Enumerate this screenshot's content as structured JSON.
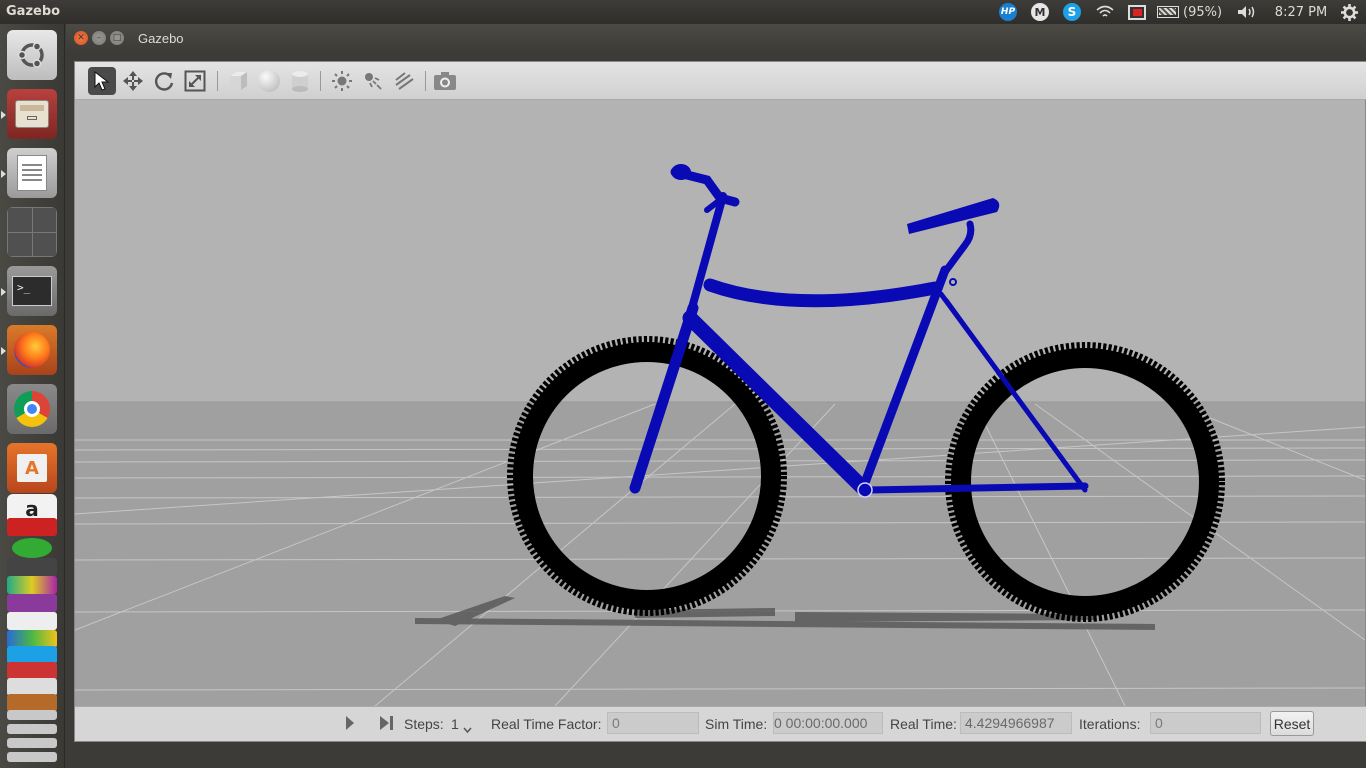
{
  "top_panel": {
    "app_name": "Gazebo",
    "tray": {
      "hp_icon": "HP",
      "mail_icon": "M",
      "battery_text": "(95%)",
      "clock": "8:27 PM"
    }
  },
  "launcher": {
    "items": [
      "ubuntu-dash",
      "files",
      "text-editor",
      "workspace-switcher",
      "terminal",
      "firefox",
      "chrome",
      "software-center",
      "amazon",
      "stacked-apps"
    ]
  },
  "window": {
    "title": "Gazebo"
  },
  "toolbar": {
    "tools": [
      "select",
      "translate",
      "rotate",
      "scale",
      "box",
      "sphere",
      "cylinder",
      "point-light",
      "spot-light",
      "directional-light",
      "screenshot"
    ]
  },
  "bottom_bar": {
    "steps_label": "Steps:",
    "steps_value": "1",
    "rtf_label": "Real Time Factor:",
    "rtf_value": "0",
    "sim_time_label": "Sim Time:",
    "sim_time_value": "0 00:00:00.000",
    "real_time_label": "Real Time:",
    "real_time_value": "4.4294966987",
    "iterations_label": "Iterations:",
    "iterations_value": "0",
    "reset_label": "Reset"
  },
  "colors": {
    "bicycle": "#0a0ab4",
    "tire": "#000000",
    "sky": "#b3b3b3",
    "ground": "#9e9e9e"
  }
}
